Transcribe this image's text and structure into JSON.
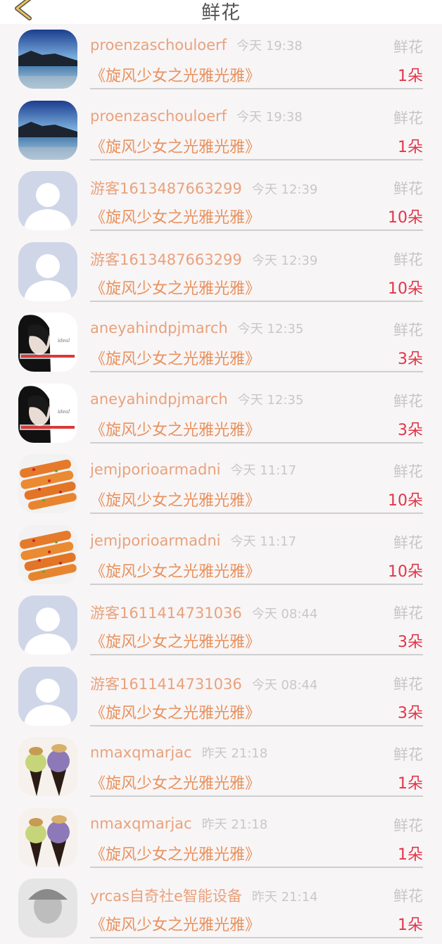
{
  "header": {
    "title": "鲜花",
    "back_icon": "chevron-left-icon",
    "accent": "#e8c25a"
  },
  "colors": {
    "name": "#e8a27c",
    "time": "#c8c8c8",
    "book": "#e8925e",
    "count": "#e0364a",
    "gift": "#c6c6c6"
  },
  "rows": [
    {
      "avatar": "lake",
      "name": "proenzaschouloerf",
      "time": "今天 19:38",
      "gift": "鲜花",
      "book": "《旋风少女之光雅光雅》",
      "count": "1朵"
    },
    {
      "avatar": "lake",
      "name": "proenzaschouloerf",
      "time": "今天 19:38",
      "gift": "鲜花",
      "book": "《旋风少女之光雅光雅》",
      "count": "1朵"
    },
    {
      "avatar": "default",
      "name": "游客1613487663299",
      "time": "今天 12:39",
      "gift": "鲜花",
      "book": "《旋风少女之光雅光雅》",
      "count": "10朵"
    },
    {
      "avatar": "default",
      "name": "游客1613487663299",
      "time": "今天 12:39",
      "gift": "鲜花",
      "book": "《旋风少女之光雅光雅》",
      "count": "10朵"
    },
    {
      "avatar": "woman",
      "name": "aneyahindpjmarch",
      "time": "今天 12:35",
      "gift": "鲜花",
      "book": "《旋风少女之光雅光雅》",
      "count": "3朵"
    },
    {
      "avatar": "woman",
      "name": "aneyahindpjmarch",
      "time": "今天 12:35",
      "gift": "鲜花",
      "book": "《旋风少女之光雅光雅》",
      "count": "3朵"
    },
    {
      "avatar": "food",
      "name": "jemjporioarmadni",
      "time": "今天 11:17",
      "gift": "鲜花",
      "book": "《旋风少女之光雅光雅》",
      "count": "10朵"
    },
    {
      "avatar": "food",
      "name": "jemjporioarmadni",
      "time": "今天 11:17",
      "gift": "鲜花",
      "book": "《旋风少女之光雅光雅》",
      "count": "10朵"
    },
    {
      "avatar": "default",
      "name": "游客1611414731036",
      "time": "今天 08:44",
      "gift": "鲜花",
      "book": "《旋风少女之光雅光雅》",
      "count": "3朵"
    },
    {
      "avatar": "default",
      "name": "游客1611414731036",
      "time": "今天 08:44",
      "gift": "鲜花",
      "book": "《旋风少女之光雅光雅》",
      "count": "3朵"
    },
    {
      "avatar": "icecream",
      "name": "nmaxqmarjac",
      "time": "昨天 21:18",
      "gift": "鲜花",
      "book": "《旋风少女之光雅光雅》",
      "count": "1朵"
    },
    {
      "avatar": "icecream",
      "name": "nmaxqmarjac",
      "time": "昨天 21:18",
      "gift": "鲜花",
      "book": "《旋风少女之光雅光雅》",
      "count": "1朵"
    },
    {
      "avatar": "gray",
      "name": "yrcas自奇社e智能设备",
      "time": "昨天 21:14",
      "gift": "鲜花",
      "book": "《旋风少女之光雅光雅》",
      "count": "1朵"
    }
  ]
}
